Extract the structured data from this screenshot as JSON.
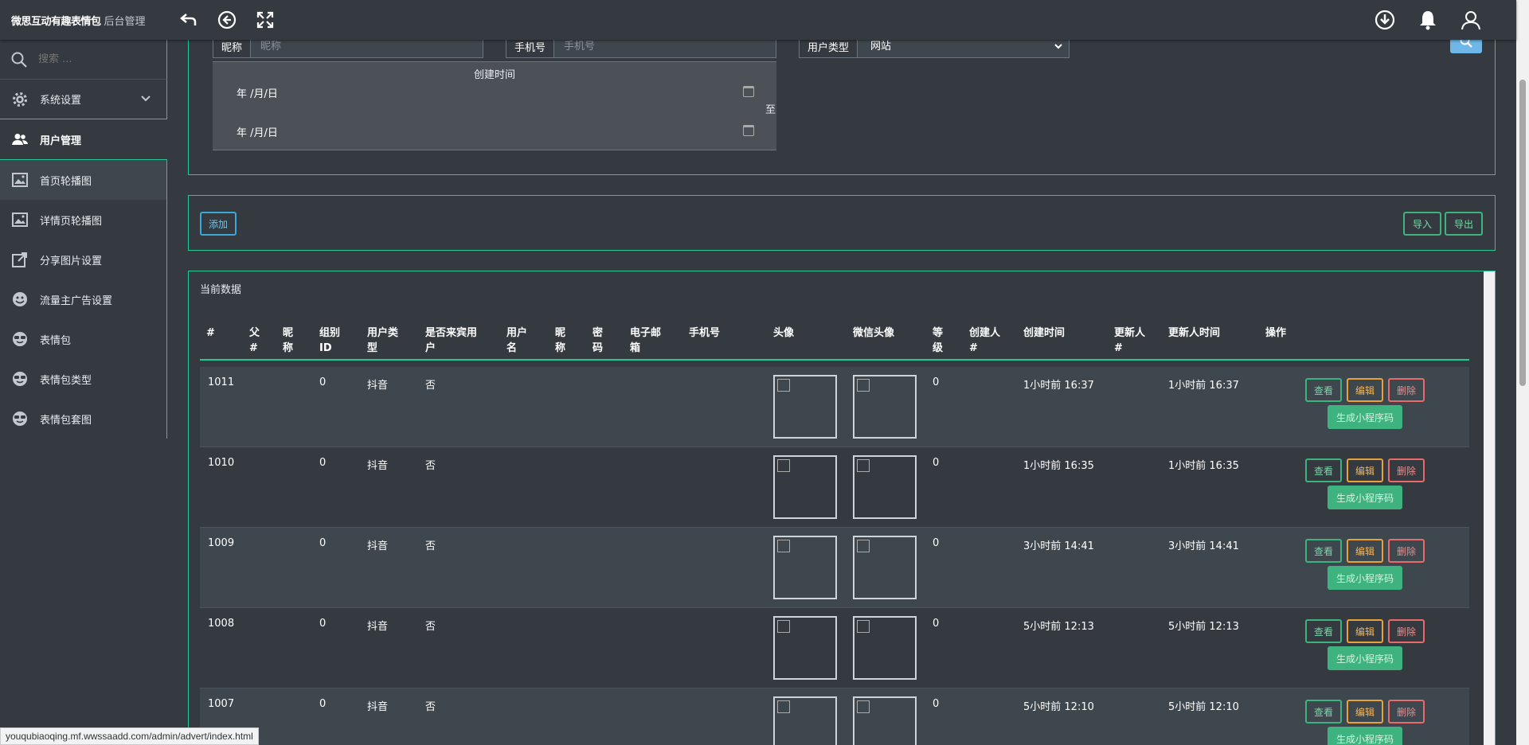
{
  "header": {
    "brand": "微思互动有趣表情包",
    "subtitle": "后台管理"
  },
  "sidebar": {
    "search_placeholder": "搜索 ...",
    "items": [
      {
        "label": "系统设置"
      },
      {
        "label": "用户管理"
      },
      {
        "label": "首页轮播图"
      },
      {
        "label": "详情页轮播图"
      },
      {
        "label": "分享图片设置"
      },
      {
        "label": "流量主广告设置"
      },
      {
        "label": "表情包"
      },
      {
        "label": "表情包类型"
      },
      {
        "label": "表情包套图"
      }
    ]
  },
  "filters": {
    "nickname_label": "昵称",
    "nickname_placeholder": "昵称",
    "phone_label": "手机号",
    "phone_placeholder": "手机号",
    "usertype_label": "用户类型",
    "usertype_value": "网站",
    "created_label": "创建时间",
    "date_placeholder": "年 /月/日",
    "to_label": "至"
  },
  "toolbar": {
    "add": "添加",
    "import": "导入",
    "export": "导出"
  },
  "table": {
    "title": "当前数据",
    "headers": {
      "id": "#",
      "parent": "父\n#",
      "nick": "昵\n称",
      "group": "组别\nID",
      "utype": "用户类\n型",
      "real": "是否来宾用\n户",
      "uname": "用户\n名",
      "nick2": "昵\n称",
      "pwd": "密\n码",
      "email": "电子邮\n箱",
      "phone": "手机号",
      "avatar": "头像",
      "wxavatar": "微信头像",
      "level": "等\n级",
      "creator": "创建人\n#",
      "ctime": "创建时间",
      "updater": "更新人\n#",
      "utime": "更新人时间",
      "ops": "操作"
    },
    "actions": {
      "view": "查看",
      "edit": "编辑",
      "delete": "删除",
      "gen": "生成小程序码"
    },
    "rows": [
      {
        "id": "1011",
        "group": "0",
        "utype": "抖音",
        "real": "否",
        "level": "0",
        "ctime": "1小时前 16:37",
        "utime": "1小时前 16:37"
      },
      {
        "id": "1010",
        "group": "0",
        "utype": "抖音",
        "real": "否",
        "level": "0",
        "ctime": "1小时前 16:35",
        "utime": "1小时前 16:35"
      },
      {
        "id": "1009",
        "group": "0",
        "utype": "抖音",
        "real": "否",
        "level": "0",
        "ctime": "3小时前 14:41",
        "utime": "3小时前 14:41"
      },
      {
        "id": "1008",
        "group": "0",
        "utype": "抖音",
        "real": "否",
        "level": "0",
        "ctime": "5小时前 12:13",
        "utime": "5小时前 12:13"
      },
      {
        "id": "1007",
        "group": "0",
        "utype": "抖音",
        "real": "否",
        "level": "0",
        "ctime": "5小时前 12:10",
        "utime": "5小时前 12:10"
      }
    ]
  },
  "status_url": "youqubiaoqing.mf.wwssaadd.com/admin/advert/index.html"
}
